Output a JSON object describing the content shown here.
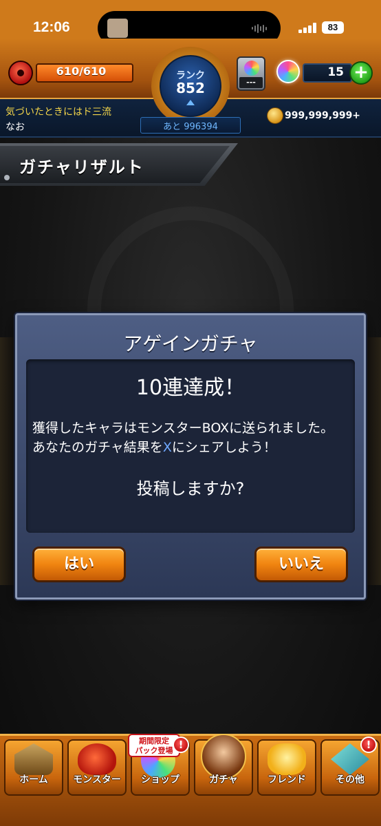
{
  "status_bar": {
    "time": "12:06",
    "battery": "83"
  },
  "header": {
    "stamina": "610/610",
    "rank_label": "ランク",
    "rank_value": "852",
    "item_box_value": "---",
    "orb_count": "15",
    "plus_label": "+",
    "player_title": "気づいたときにはド三流",
    "player_name": "なお",
    "next_rank": "あと 996394",
    "coins": "999,999,999+"
  },
  "page": {
    "title": "ガチャリザルト"
  },
  "dialog": {
    "heading": "アゲインガチャ",
    "subheading": "10連達成！",
    "message_line1": "獲得したキャラはモンスターBOXに送られました。",
    "message_line2_pre": "あなたのガチャ結果を",
    "message_line2_x": "X",
    "message_line2_post": "にシェアしよう！",
    "question": "投稿しますか?",
    "yes_label": "はい",
    "no_label": "いいえ"
  },
  "nav": {
    "items": [
      {
        "label": "ホーム",
        "icon": "home-icon"
      },
      {
        "label": "モンスター",
        "icon": "monster-icon"
      },
      {
        "label": "ショップ",
        "icon": "shop-icon"
      },
      {
        "label": "ガチャ",
        "icon": "gacha-icon"
      },
      {
        "label": "フレンド",
        "icon": "friend-icon"
      },
      {
        "label": "その他",
        "icon": "other-icon"
      }
    ],
    "limited_tag": "期間限定\nパック登場",
    "badge": "!"
  },
  "colors": {
    "accent_orange": "#f08410",
    "dialog_blue": "#2c3856",
    "header_navy": "#0a172a",
    "x_highlight": "#6fa8ff"
  }
}
